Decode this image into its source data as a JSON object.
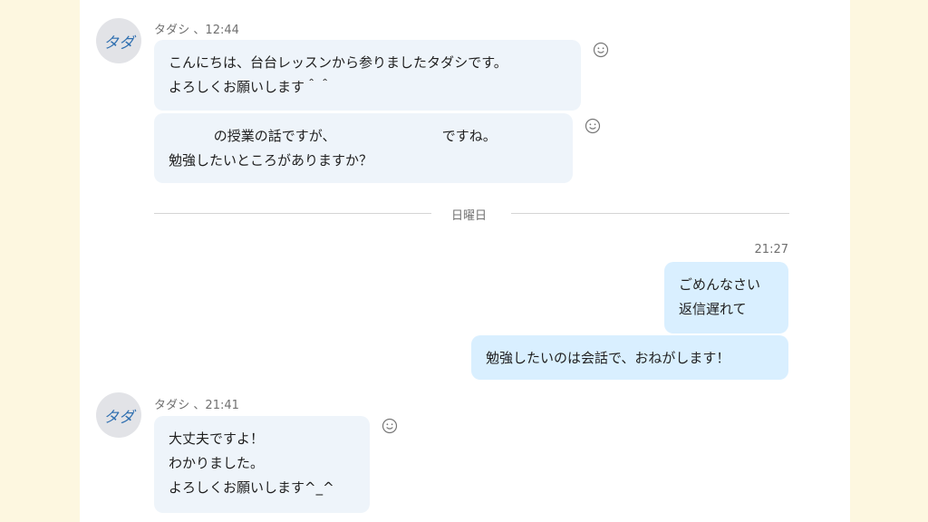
{
  "messages": [
    {
      "sender": "タダシ",
      "avatar": "タダ",
      "time": "12:44",
      "bubbles": [
        {
          "lines": [
            "こんにちは、台台レッスンから参りましたタダシです。",
            "よろしくお願いします＾＾"
          ]
        },
        {
          "lines": [
            "　　　 の授業の話ですが、　　　　　　　　 ですね。",
            "勉強したいところがありますか？"
          ]
        }
      ]
    },
    {
      "divider": "日曜日"
    },
    {
      "sender": "me",
      "time": "21:27",
      "bubbles": [
        {
          "lines": [
            "ごめんなさい",
            "返信遅れて"
          ]
        },
        {
          "lines": [
            "勉強したいのは会話で、おねがします！"
          ]
        }
      ]
    },
    {
      "sender": "タダシ",
      "avatar": "タダ",
      "time": "21:41",
      "bubbles": [
        {
          "lines": [
            "大丈夫ですよ！",
            "わかりました。",
            "よろしくお願いします^_^"
          ]
        }
      ]
    }
  ],
  "meta_separator": "、",
  "icons": {
    "reaction": "smiley-icon"
  }
}
